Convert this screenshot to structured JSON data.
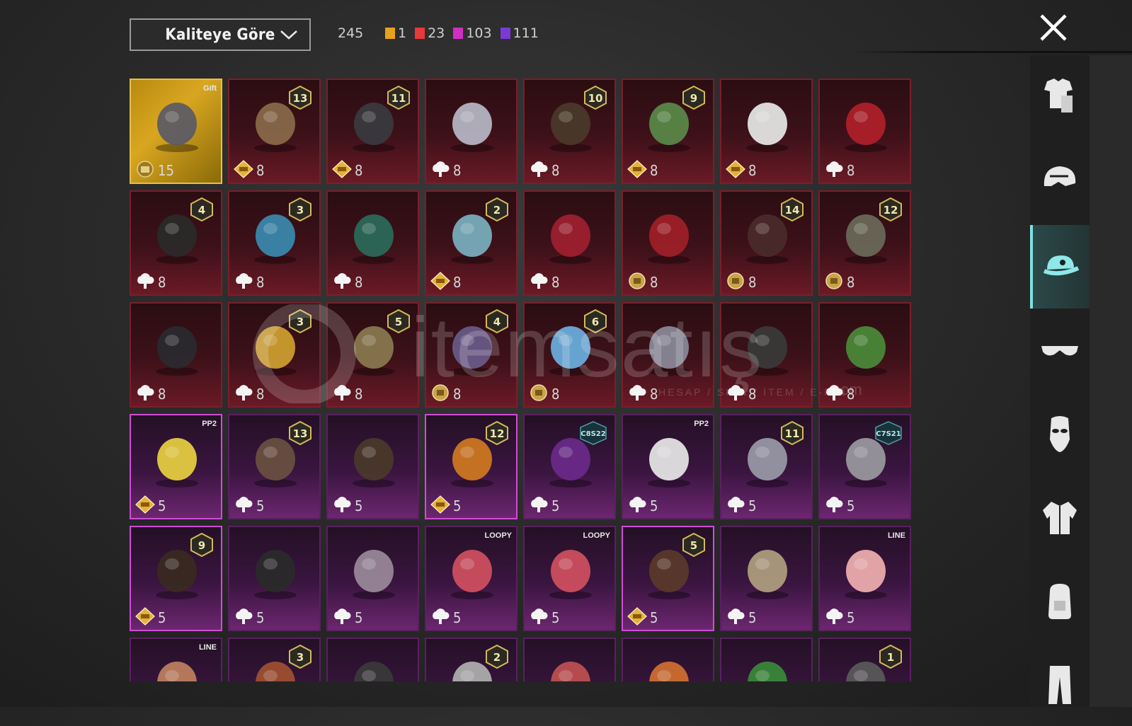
{
  "toolbar": {
    "sort_label": "Kaliteye Göre",
    "total": "245",
    "counts": [
      {
        "num": "1",
        "color": "#e8a21a"
      },
      {
        "num": "23",
        "color": "#e63a3a"
      },
      {
        "num": "103",
        "color": "#d12fc4"
      },
      {
        "num": "111",
        "color": "#7a3ad6"
      }
    ]
  },
  "sidebar": {
    "items": [
      {
        "icon": "outfit-icon"
      },
      {
        "icon": "helmet-icon"
      },
      {
        "icon": "cap-icon",
        "active": true
      },
      {
        "icon": "glasses-icon"
      },
      {
        "icon": "mask-icon"
      },
      {
        "icon": "jacket-icon"
      },
      {
        "icon": "backpack-icon"
      },
      {
        "icon": "pants-icon"
      }
    ]
  },
  "watermark": {
    "brand": "itemsatış",
    "tagline": "HESAP / SKIN / İTEM / E-PIN",
    "domain": ".com"
  },
  "items": [
    {
      "rarity": "gold",
      "val": "15",
      "cur": "gift",
      "badge": "Gift",
      "tier": ""
    },
    {
      "rarity": "red",
      "val": "8",
      "cur": "diamond",
      "tier": "13"
    },
    {
      "rarity": "red",
      "val": "8",
      "cur": "diamond",
      "tier": "11"
    },
    {
      "rarity": "red",
      "val": "8",
      "cur": "cloud",
      "tier": ""
    },
    {
      "rarity": "red",
      "val": "8",
      "cur": "cloud",
      "tier": "10"
    },
    {
      "rarity": "red",
      "val": "8",
      "cur": "diamond",
      "tier": "9"
    },
    {
      "rarity": "red",
      "val": "8",
      "cur": "diamond",
      "tier": ""
    },
    {
      "rarity": "red",
      "val": "8",
      "cur": "cloud",
      "tier": ""
    },
    {
      "rarity": "red",
      "val": "8",
      "cur": "cloud",
      "tier": "4"
    },
    {
      "rarity": "red",
      "val": "8",
      "cur": "cloud",
      "tier": "3"
    },
    {
      "rarity": "red",
      "val": "8",
      "cur": "cloud",
      "tier": ""
    },
    {
      "rarity": "red",
      "val": "8",
      "cur": "diamond",
      "tier": "2"
    },
    {
      "rarity": "red",
      "val": "8",
      "cur": "cloud",
      "tier": ""
    },
    {
      "rarity": "red",
      "val": "8",
      "cur": "coin",
      "tier": ""
    },
    {
      "rarity": "red",
      "val": "8",
      "cur": "coin",
      "tier": "14"
    },
    {
      "rarity": "red",
      "val": "8",
      "cur": "coin",
      "tier": "12"
    },
    {
      "rarity": "red",
      "val": "8",
      "cur": "cloud",
      "tier": ""
    },
    {
      "rarity": "red",
      "val": "8",
      "cur": "cloud",
      "tier": "3"
    },
    {
      "rarity": "red",
      "val": "8",
      "cur": "cloud",
      "tier": "5"
    },
    {
      "rarity": "red",
      "val": "8",
      "cur": "coin",
      "tier": "4"
    },
    {
      "rarity": "red",
      "val": "8",
      "cur": "coin",
      "tier": "6"
    },
    {
      "rarity": "red",
      "val": "8",
      "cur": "cloud",
      "tier": ""
    },
    {
      "rarity": "red",
      "val": "8",
      "cur": "cloud",
      "tier": ""
    },
    {
      "rarity": "red",
      "val": "8",
      "cur": "cloud",
      "tier": ""
    },
    {
      "rarity": "purple",
      "val": "5",
      "cur": "diamond",
      "tier": "",
      "badge": "PP2",
      "sel": true
    },
    {
      "rarity": "purple",
      "val": "5",
      "cur": "cloud",
      "tier": "13"
    },
    {
      "rarity": "purple",
      "val": "5",
      "cur": "cloud",
      "tier": ""
    },
    {
      "rarity": "purple",
      "val": "5",
      "cur": "diamond",
      "tier": "12",
      "sel": true
    },
    {
      "rarity": "purple",
      "val": "5",
      "cur": "cloud",
      "tier": "C8S22"
    },
    {
      "rarity": "purple",
      "val": "5",
      "cur": "cloud",
      "tier": "",
      "badge": "PP2"
    },
    {
      "rarity": "purple",
      "val": "5",
      "cur": "cloud",
      "tier": "11"
    },
    {
      "rarity": "purple",
      "val": "5",
      "cur": "cloud",
      "tier": "C7S21"
    },
    {
      "rarity": "purple",
      "val": "5",
      "cur": "diamond",
      "tier": "9",
      "sel": true
    },
    {
      "rarity": "purple",
      "val": "5",
      "cur": "cloud",
      "tier": ""
    },
    {
      "rarity": "purple",
      "val": "5",
      "cur": "cloud",
      "tier": ""
    },
    {
      "rarity": "purple",
      "val": "5",
      "cur": "cloud",
      "tier": "",
      "badge": "LOOPY"
    },
    {
      "rarity": "purple",
      "val": "5",
      "cur": "cloud",
      "tier": "",
      "badge": "LOOPY"
    },
    {
      "rarity": "purple",
      "val": "5",
      "cur": "diamond",
      "tier": "5",
      "sel": true
    },
    {
      "rarity": "purple",
      "val": "5",
      "cur": "cloud",
      "tier": ""
    },
    {
      "rarity": "purple",
      "val": "5",
      "cur": "cloud",
      "tier": "",
      "badge": "LINE"
    },
    {
      "rarity": "purple",
      "val": "",
      "cur": "",
      "tier": "",
      "badge": "LINE"
    },
    {
      "rarity": "purple",
      "val": "",
      "cur": "",
      "tier": "3"
    },
    {
      "rarity": "purple",
      "val": "",
      "cur": "",
      "tier": ""
    },
    {
      "rarity": "purple",
      "val": "",
      "cur": "",
      "tier": "2"
    },
    {
      "rarity": "purple",
      "val": "",
      "cur": "",
      "tier": ""
    },
    {
      "rarity": "purple",
      "val": "",
      "cur": "",
      "tier": ""
    },
    {
      "rarity": "purple",
      "val": "",
      "cur": "",
      "tier": ""
    },
    {
      "rarity": "purple",
      "val": "",
      "cur": "",
      "tier": "1"
    }
  ]
}
